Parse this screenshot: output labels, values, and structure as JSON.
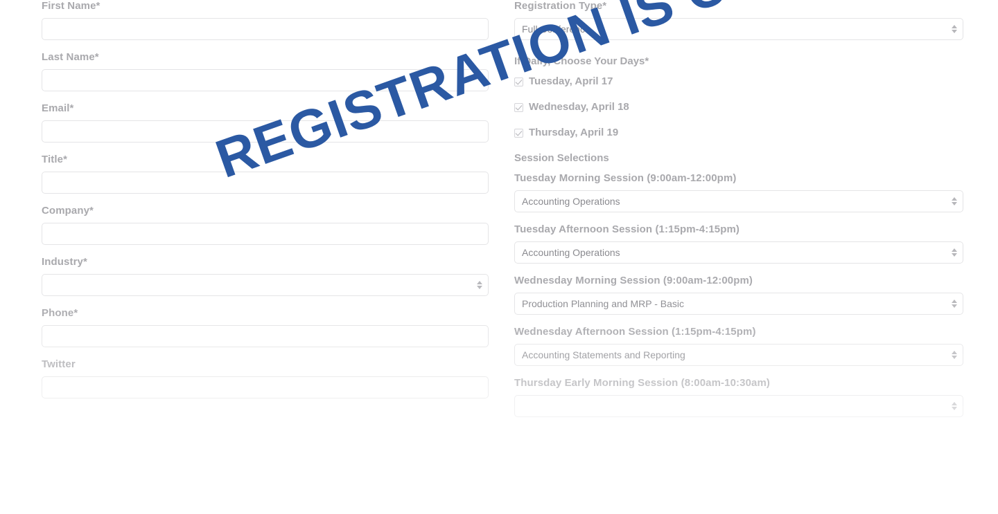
{
  "overlay": {
    "stamp_text": "REGISTRATION IS CLOSED",
    "stamp_color": "#2b59a3",
    "stamp_rotation_deg": -19.5
  },
  "theme": {
    "label_color": "#a9a9ad",
    "input_border_color": "#e4e4e6",
    "input_text_color": "#8a8a8f",
    "background": "#ffffff"
  },
  "left_column": {
    "fields": [
      {
        "label": "First Name*",
        "type": "text",
        "value": "",
        "placeholder": ""
      },
      {
        "label": "Last Name*",
        "type": "text",
        "value": "",
        "placeholder": ""
      },
      {
        "label": "Email*",
        "type": "text",
        "value": "",
        "placeholder": ""
      },
      {
        "label": "Title*",
        "type": "text",
        "value": "",
        "placeholder": ""
      },
      {
        "label": "Company*",
        "type": "text",
        "value": "",
        "placeholder": ""
      },
      {
        "label": "Industry*",
        "type": "select",
        "value": "",
        "placeholder": ""
      },
      {
        "label": "Phone*",
        "type": "text",
        "value": "",
        "placeholder": ""
      },
      {
        "label": "Twitter",
        "type": "text",
        "value": "",
        "placeholder": ""
      }
    ]
  },
  "right_column": {
    "registration_type": {
      "label": "Registration Type*",
      "value": "Full Conference"
    },
    "days": {
      "label": "If Daily, Choose Your Days*",
      "options": [
        {
          "label": "Tuesday, April 17",
          "checked": true
        },
        {
          "label": "Wednesday, April 18",
          "checked": true
        },
        {
          "label": "Thursday, April 19",
          "checked": true
        }
      ]
    },
    "sessions": {
      "heading": "Session Selections",
      "items": [
        {
          "label": "Tuesday Morning Session (9:00am-12:00pm)",
          "value": "Accounting Operations"
        },
        {
          "label": "Tuesday Afternoon Session (1:15pm-4:15pm)",
          "value": "Accounting Operations"
        },
        {
          "label": "Wednesday Morning Session (9:00am-12:00pm)",
          "value": "Production Planning and MRP - Basic"
        },
        {
          "label": "Wednesday Afternoon Session (1:15pm-4:15pm)",
          "value": "Accounting Statements and Reporting"
        },
        {
          "label": "Thursday Early Morning Session (8:00am-10:30am)",
          "value": ""
        }
      ]
    }
  }
}
